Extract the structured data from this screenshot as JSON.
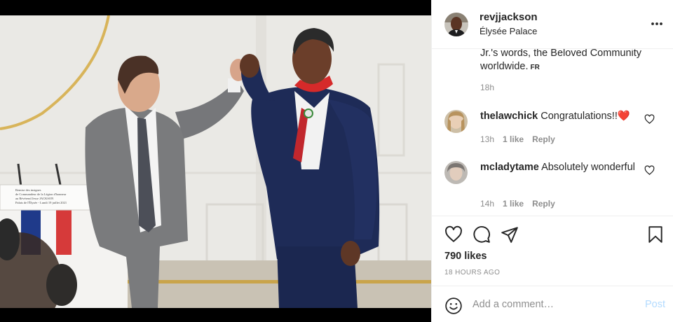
{
  "header": {
    "username": "revjjackson",
    "location": "Élysée Palace",
    "more_icon": "more-horizontal-icon"
  },
  "photo": {
    "placard_text": [
      "Remise des insignes",
      "de Commandeur de la Légion d'honneur",
      "au Révérend Jesse JACKSON",
      "Palais de l'Élysée - Lundi 19 juillet 2021"
    ]
  },
  "caption": {
    "text": "Jr.'s words, the Beloved Community worldwide.",
    "translate": "FR",
    "time": "18h"
  },
  "comments": [
    {
      "username": "thelawchick",
      "text": "Congratulations!!",
      "emoji": "❤️",
      "time": "13h",
      "likes": "1 like",
      "reply": "Reply"
    },
    {
      "username": "mcladytame",
      "text": "Absolutely wonderful",
      "time": "14h",
      "likes": "1 like",
      "reply": "Reply"
    }
  ],
  "actions": {
    "likes": "790 likes",
    "time_ago": "18 HOURS AGO"
  },
  "add_comment": {
    "placeholder": "Add a comment…",
    "post_label": "Post"
  },
  "colors": {
    "post_button_disabled": "#b3dbff",
    "heart_red": "#ed4956",
    "muted_text": "#8e8e8e"
  }
}
